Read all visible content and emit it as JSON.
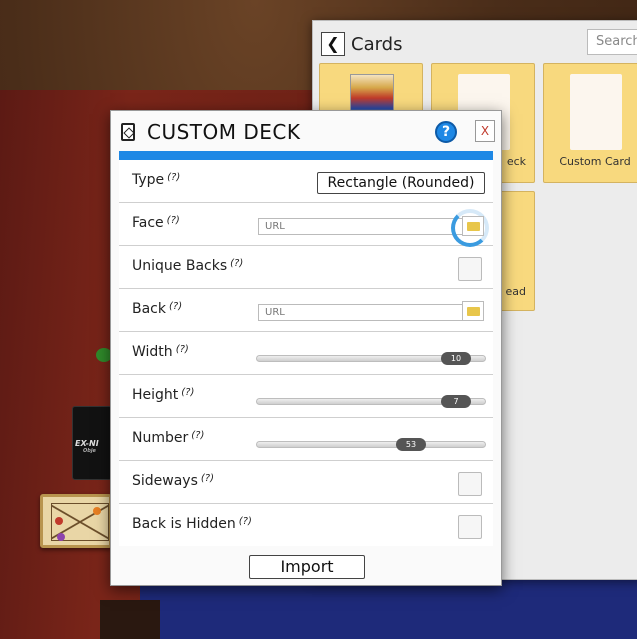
{
  "cards_panel": {
    "title": "Cards",
    "search_placeholder": "Search",
    "tiles": [
      {
        "caption": ""
      },
      {
        "caption": "eck"
      },
      {
        "caption": "Custom Card"
      },
      {
        "caption": "ead"
      }
    ]
  },
  "background": {
    "black_card_text": "EX-NI",
    "black_card_sub": "Obje"
  },
  "dialog": {
    "title": "CUSTOM DECK",
    "help_label": "?",
    "close_label": "X",
    "rows": {
      "type": {
        "label": "Type",
        "hint": "(?)",
        "value": "Rectangle (Rounded)"
      },
      "face": {
        "label": "Face",
        "hint": "(?)",
        "placeholder": "URL"
      },
      "unique_backs": {
        "label": "Unique Backs",
        "hint": "(?)",
        "checked": false
      },
      "back": {
        "label": "Back",
        "hint": "(?)",
        "placeholder": "URL"
      },
      "width": {
        "label": "Width",
        "hint": "(?)",
        "value": "10",
        "fraction": 0.93
      },
      "height": {
        "label": "Height",
        "hint": "(?)",
        "value": "7",
        "fraction": 0.93
      },
      "number": {
        "label": "Number",
        "hint": "(?)",
        "value": "53",
        "fraction": 0.7
      },
      "sideways": {
        "label": "Sideways",
        "hint": "(?)",
        "checked": false
      },
      "back_is_hidden": {
        "label": "Back is Hidden",
        "hint": "(?)",
        "checked": false
      }
    },
    "import_label": "Import"
  },
  "colors": {
    "accent_blue": "#1e88e5",
    "tile_yellow": "#f8d97e",
    "folder_yellow": "#e8c64a"
  }
}
